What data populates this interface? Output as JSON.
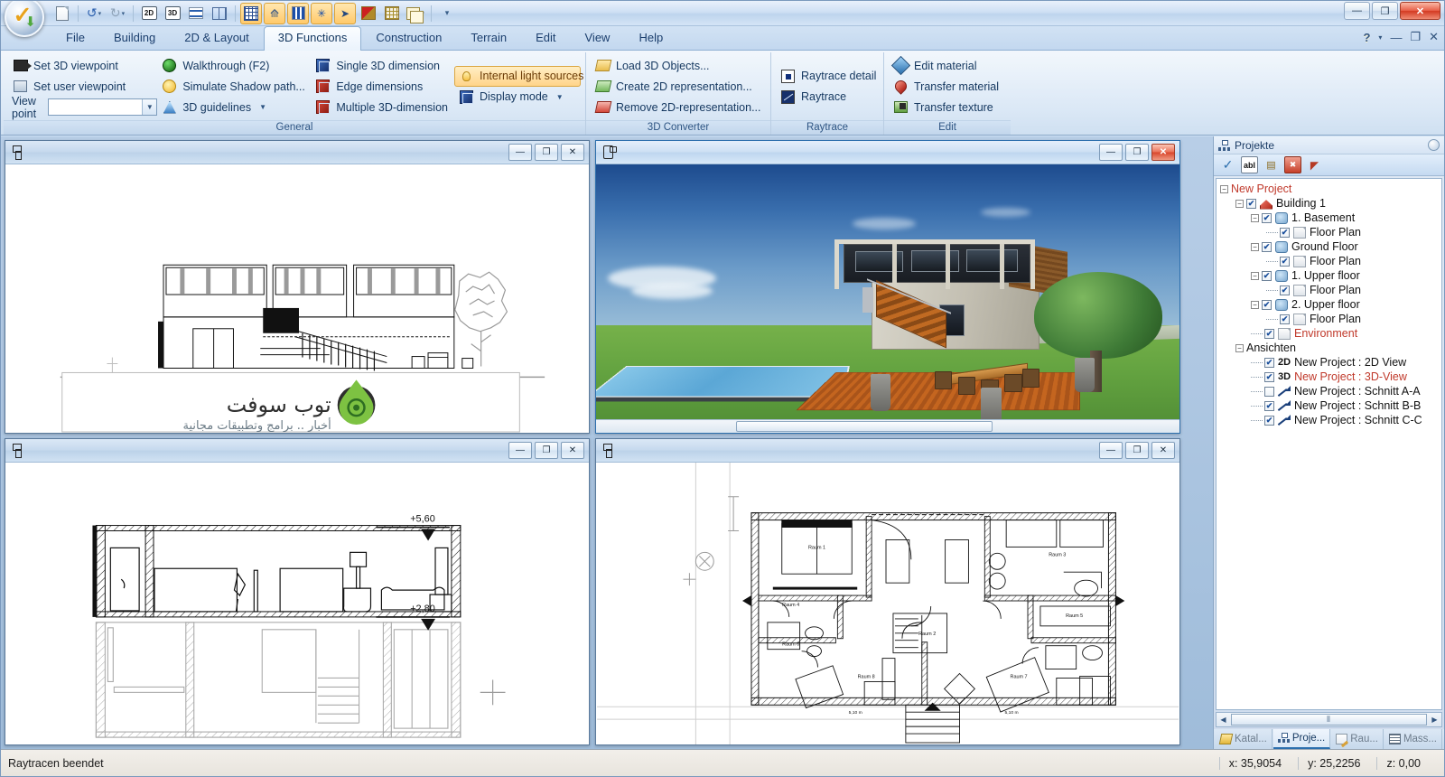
{
  "app": {
    "window_buttons": {
      "minimize": "—",
      "maximize": "❐",
      "close": "✕"
    },
    "ribbon_window_buttons": {
      "minimize": "—",
      "maximize": "❐",
      "close": "✕"
    },
    "help_glyph": "?",
    "help_dropdown": "▾"
  },
  "quick_access": [
    {
      "name": "new-document",
      "label": "New"
    },
    {
      "name": "undo",
      "label": "Undo"
    },
    {
      "name": "redo",
      "label": "Redo"
    },
    {
      "name": "2d-mode",
      "label": "2D"
    },
    {
      "name": "3d-mode",
      "label": "3D"
    },
    {
      "name": "lines-view",
      "label": "Lines"
    },
    {
      "name": "split-view",
      "label": "Split"
    },
    {
      "name": "grid",
      "label": "Grid"
    },
    {
      "name": "select-point",
      "label": "Select point"
    },
    {
      "name": "layers",
      "label": "Layers"
    },
    {
      "name": "snap",
      "label": "Snap"
    },
    {
      "name": "pointer",
      "label": "Pointer"
    },
    {
      "name": "roof",
      "label": "Roof"
    },
    {
      "name": "truss",
      "label": "Truss"
    },
    {
      "name": "copy",
      "label": "Copy"
    },
    {
      "name": "qat-overflow",
      "label": "More"
    }
  ],
  "tabs": [
    {
      "label": "File",
      "active": false
    },
    {
      "label": "Building",
      "active": false
    },
    {
      "label": "2D & Layout",
      "active": false
    },
    {
      "label": "3D Functions",
      "active": true
    },
    {
      "label": "Construction",
      "active": false
    },
    {
      "label": "Terrain",
      "active": false
    },
    {
      "label": "Edit",
      "active": false
    },
    {
      "label": "View",
      "active": false
    },
    {
      "label": "Help",
      "active": false
    }
  ],
  "ribbon": {
    "groups": [
      {
        "title": "General",
        "columns": [
          {
            "items": [
              {
                "label": "Set 3D viewpoint",
                "icon": "camera-icon",
                "selected": false
              },
              {
                "label": "Set user viewpoint",
                "icon": "house-view-icon",
                "selected": false
              }
            ],
            "viewpoint": {
              "label": "View point",
              "value": "",
              "placeholder": ""
            }
          },
          {
            "items": [
              {
                "label": "Walkthrough (F2)",
                "icon": "walkthrough-icon",
                "selected": false
              },
              {
                "label": "Simulate Shadow path...",
                "icon": "sun-clock-icon",
                "selected": false
              },
              {
                "label": "3D guidelines",
                "icon": "guideline-icon",
                "selected": false,
                "dropdown": true
              }
            ]
          },
          {
            "items": [
              {
                "label": "Single 3D dimension",
                "icon": "cube-dimension-icon",
                "selected": false
              },
              {
                "label": "Edge dimensions",
                "icon": "cube-edge-icon",
                "selected": false
              },
              {
                "label": "Multiple 3D-dimension",
                "icon": "cube-multi-icon",
                "selected": false
              }
            ]
          },
          {
            "items": [
              {
                "label": "Internal light sources",
                "icon": "lightbulb-icon",
                "selected": true
              },
              {
                "label": "Display mode",
                "icon": "cube-display-icon",
                "selected": false,
                "dropdown": true
              }
            ]
          }
        ]
      },
      {
        "title": "3D Converter",
        "columns": [
          {
            "items": [
              {
                "label": "Load 3D Objects...",
                "icon": "load-object-icon",
                "selected": false
              },
              {
                "label": "Create 2D representation...",
                "icon": "create-2d-icon",
                "selected": false
              },
              {
                "label": "Remove 2D-representation...",
                "icon": "remove-2d-icon",
                "selected": false
              }
            ]
          }
        ]
      },
      {
        "title": "Raytrace",
        "columns": [
          {
            "items": [
              {
                "label": "Raytrace detail",
                "icon": "raytrace-detail-icon",
                "selected": false
              },
              {
                "label": "Raytrace",
                "icon": "raytrace-icon",
                "selected": false
              }
            ]
          }
        ]
      },
      {
        "title": "Edit",
        "columns": [
          {
            "items": [
              {
                "label": "Edit material",
                "icon": "pen-material-icon",
                "selected": false
              },
              {
                "label": "Transfer material",
                "icon": "transfer-material-icon",
                "selected": false
              },
              {
                "label": "Transfer texture",
                "icon": "transfer-texture-icon",
                "selected": false
              }
            ]
          }
        ]
      }
    ]
  },
  "windows": {
    "elevation": {
      "title": "",
      "watermark": "توب سوفت",
      "watermark_sub": "أخبار .. برامج وتطبيقات مجانية"
    },
    "render3d": {
      "title": ""
    },
    "section": {
      "title": "",
      "level_upper": "+5,60",
      "level_lower": "+2,80"
    },
    "floorplan": {
      "title": "",
      "rooms": [
        "Raum 1",
        "Raum 2",
        "Raum 3",
        "Raum 4",
        "Raum 5",
        "Raum 6",
        "Raum 7",
        "Raum 8"
      ],
      "dim_left": "5,10 m",
      "dim_right": "5,10 m"
    }
  },
  "project_panel": {
    "title": "Projekte",
    "toolbar": [
      {
        "name": "apply-check-icon",
        "glyph": "✓"
      },
      {
        "name": "rename-abl-icon",
        "glyph": "abl"
      },
      {
        "name": "properties-icon",
        "glyph": "▤"
      },
      {
        "name": "delete-icon",
        "glyph": "✖"
      },
      {
        "name": "new-view-icon",
        "glyph": "◤"
      }
    ],
    "tree": [
      {
        "label": "New Project",
        "depth": 0,
        "expander": "−",
        "checkbox": null,
        "icon": null,
        "color": "red"
      },
      {
        "label": "Building 1",
        "depth": 1,
        "expander": "−",
        "checkbox": true,
        "icon": "building-icon",
        "color": "black"
      },
      {
        "label": "1. Basement",
        "depth": 2,
        "expander": "−",
        "checkbox": true,
        "icon": "floor-icon",
        "color": "black"
      },
      {
        "label": "Floor Plan",
        "depth": 3,
        "expander": null,
        "checkbox": true,
        "icon": "page-icon",
        "color": "black"
      },
      {
        "label": "Ground Floor",
        "depth": 2,
        "expander": "−",
        "checkbox": true,
        "icon": "floor-icon",
        "color": "black"
      },
      {
        "label": "Floor Plan",
        "depth": 3,
        "expander": null,
        "checkbox": true,
        "icon": "page-icon",
        "color": "black"
      },
      {
        "label": "1. Upper floor",
        "depth": 2,
        "expander": "−",
        "checkbox": true,
        "icon": "floor-icon",
        "color": "black"
      },
      {
        "label": "Floor Plan",
        "depth": 3,
        "expander": null,
        "checkbox": true,
        "icon": "page-icon",
        "color": "black"
      },
      {
        "label": "2. Upper floor",
        "depth": 2,
        "expander": "−",
        "checkbox": true,
        "icon": "floor-icon",
        "color": "black"
      },
      {
        "label": "Floor Plan",
        "depth": 3,
        "expander": null,
        "checkbox": true,
        "icon": "page-icon",
        "color": "black"
      },
      {
        "label": "Environment",
        "depth": 2,
        "expander": null,
        "checkbox": true,
        "icon": "page-icon",
        "color": "red"
      },
      {
        "label": "Ansichten",
        "depth": 1,
        "expander": "−",
        "checkbox": null,
        "icon": null,
        "color": "black"
      },
      {
        "label": "New Project : 2D View",
        "depth": 2,
        "expander": null,
        "checkbox": true,
        "icon": null,
        "tag": "2D",
        "color": "black"
      },
      {
        "label": "New Project : 3D-View",
        "depth": 2,
        "expander": null,
        "checkbox": true,
        "icon": null,
        "tag": "3D",
        "color": "red"
      },
      {
        "label": "New Project : Schnitt A-A",
        "depth": 2,
        "expander": null,
        "checkbox": false,
        "icon": "section-icon",
        "color": "black"
      },
      {
        "label": "New Project : Schnitt B-B",
        "depth": 2,
        "expander": null,
        "checkbox": true,
        "icon": "section-icon",
        "color": "black"
      },
      {
        "label": "New Project : Schnitt C-C",
        "depth": 2,
        "expander": null,
        "checkbox": true,
        "icon": "section-icon",
        "color": "black"
      }
    ],
    "scroll": {
      "left_arrow": "◀",
      "right_arrow": "▶",
      "grip": "⦀"
    },
    "tabs": [
      {
        "label": "Katal...",
        "icon": "catalog-icon",
        "selected": false
      },
      {
        "label": "Proje...",
        "icon": "projects-icon",
        "selected": true
      },
      {
        "label": "Rau...",
        "icon": "rooms-icon",
        "selected": false
      },
      {
        "label": "Mass...",
        "icon": "measure-icon",
        "selected": false
      }
    ]
  },
  "status": {
    "message": "Raytracen beendet",
    "x": "x: 35,9054",
    "y": "y: 25,2256",
    "z": "z: 0,00"
  },
  "colors": {
    "accent": "#2c6fad",
    "highlight": "#ffd489",
    "red_label": "#c0392b"
  }
}
